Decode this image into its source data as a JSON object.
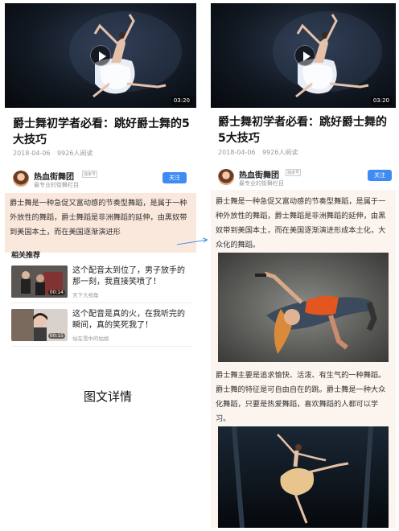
{
  "colors": {
    "accent": "#3e8bf3",
    "highlight": "#fbe8dc",
    "arrow": "#4a90e2"
  },
  "article": {
    "title": "爵士舞初学者必看：跳好爵士舞的5大技巧",
    "date": "2018-04-06",
    "reads": "9926人阅读",
    "video_duration": "03:20"
  },
  "author": {
    "name": "热血街舞团",
    "badge": "独家号",
    "subtitle": "最专业的街舞栏目",
    "follow_label": "关注"
  },
  "paragraph_1": "爵士舞是一种急促又富动感的节奏型舞蹈，是属于一种外放性的舞蹈，爵士舞蹈是非洲舞蹈的延伸，由黑奴带到美国本土，而在美国逐渐演进形成本土化，大众化的舞蹈。",
  "paragraph_1_left": "爵士舞是一种急促又富动感的节奏型舞蹈，是属于一种外放性的舞蹈，爵士舞蹈是非洲舞蹈的延伸，由黑奴带到美国本土，而在美国逐渐演进形",
  "paragraph_2": "爵士舞主要是追求愉快、活泼、有生气的一种舞蹈。爵士舞的特征是可自由自在的跳。爵士舞是一种大众化舞蹈，只要是热爱舞蹈，喜欢舞蹈的人都可以学习。",
  "related": {
    "label": "相关推荐",
    "items": [
      {
        "title": "这个配音太到位了，男子放手的那一刻，我直接笑喷了！",
        "source": "天下大视角",
        "duration": "00:14"
      },
      {
        "title": "这个配音是真的火，在我听完的瞬间，真的笑死我了！",
        "source": "站在雪中的姑娘",
        "duration": "00:15"
      }
    ]
  },
  "caption": "图文详情",
  "icons": [
    "play-icon",
    "arrow-icon"
  ]
}
